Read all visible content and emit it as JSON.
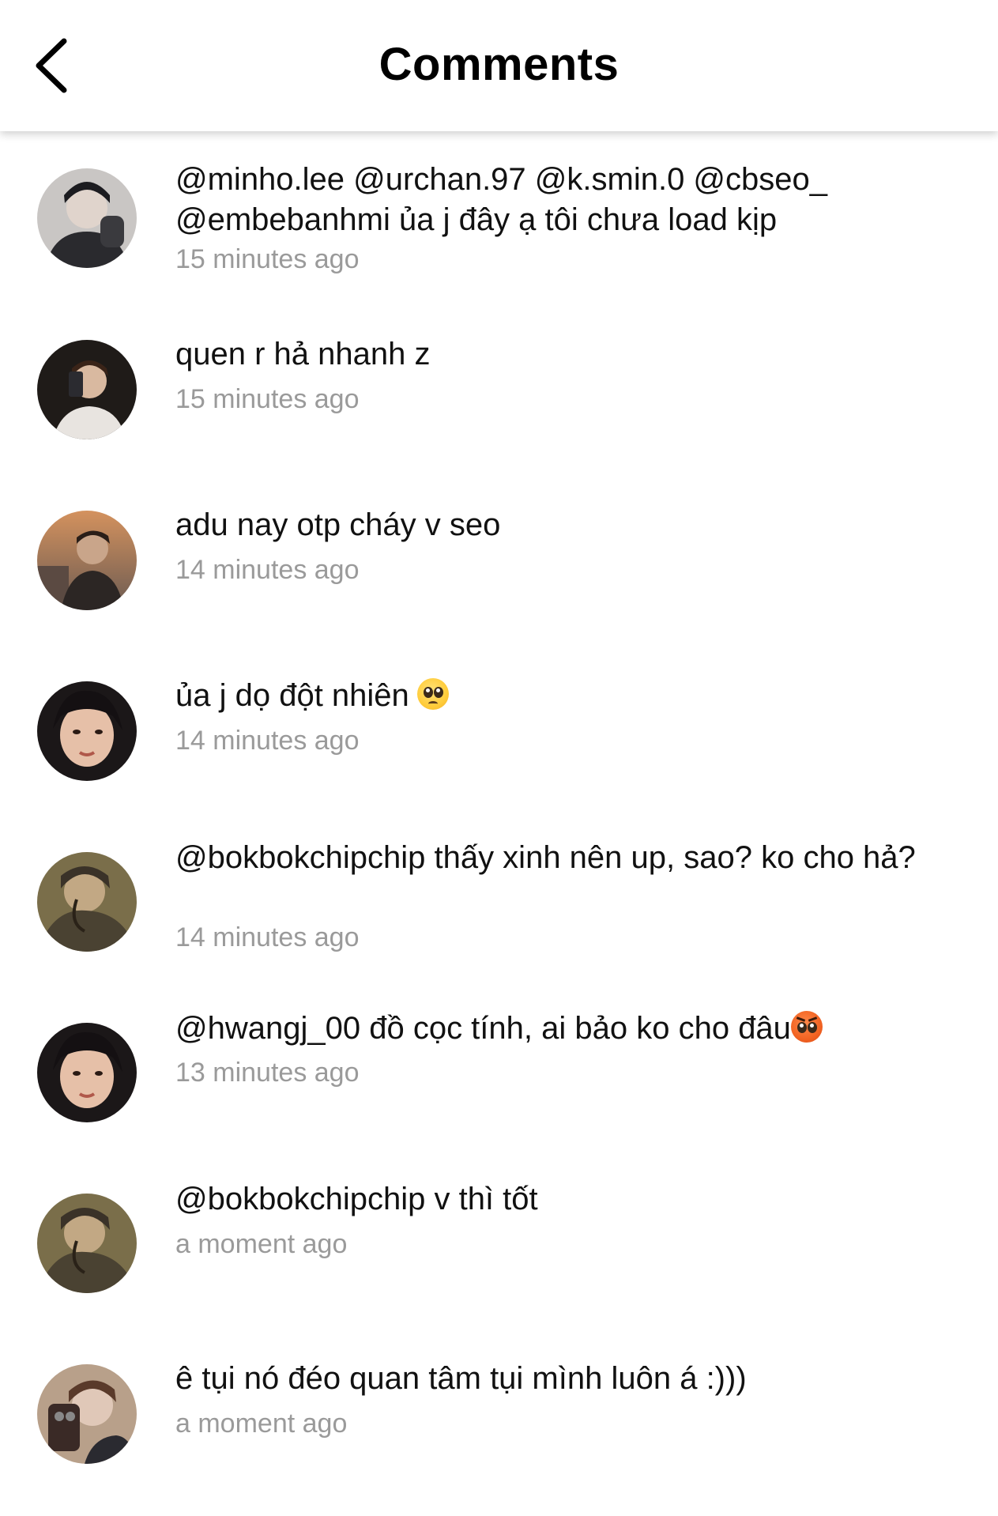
{
  "header": {
    "title": "Comments"
  },
  "comments": [
    {
      "text": "@minho.lee @urchan.97 @k.smin.0 @cbseo_ @embebanhmi ủa j đây ạ tôi chưa load kịp",
      "time": "15 minutes ago",
      "avatar_colors": [
        "#6d6a70",
        "#2a2a2e",
        "#c9c6c4"
      ]
    },
    {
      "text": "quen r hả nhanh z",
      "time": "15 minutes ago",
      "avatar_colors": [
        "#3a3430",
        "#1f1b18",
        "#d9b9a0"
      ]
    },
    {
      "text": "adu nay otp cháy v seo",
      "time": "14 minutes ago",
      "avatar_colors": [
        "#b8845a",
        "#5b4a42",
        "#2c2624"
      ]
    },
    {
      "text": "ủa j dọ đột nhiên",
      "time": "14 minutes ago",
      "emoji": "pleading-face",
      "avatar_colors": [
        "#1b1718",
        "#e6c0a8",
        "#8a5a48"
      ]
    },
    {
      "text": "@bokbokchipchip thấy xinh nên up, sao? ko cho hả?",
      "time": "14 minutes ago",
      "avatar_colors": [
        "#4a4232",
        "#7a6e4a",
        "#c2a884"
      ]
    },
    {
      "text": "@hwangj_00 đồ cọc tính, ai bảo ko cho đâu",
      "time": "13 minutes ago",
      "emoji": "angry-face",
      "avatar_colors": [
        "#1b1718",
        "#e6c0a8",
        "#8a5a48"
      ]
    },
    {
      "text": "@bokbokchipchip v thì tốt",
      "time": "a moment ago",
      "avatar_colors": [
        "#4a4232",
        "#7a6e4a",
        "#c2a884"
      ]
    },
    {
      "text": "ê tụi nó đéo quan tâm tụi mình luôn á :)))",
      "time": "a moment ago",
      "avatar_colors": [
        "#b8a08a",
        "#3a2a26",
        "#e0c8b8"
      ]
    }
  ]
}
